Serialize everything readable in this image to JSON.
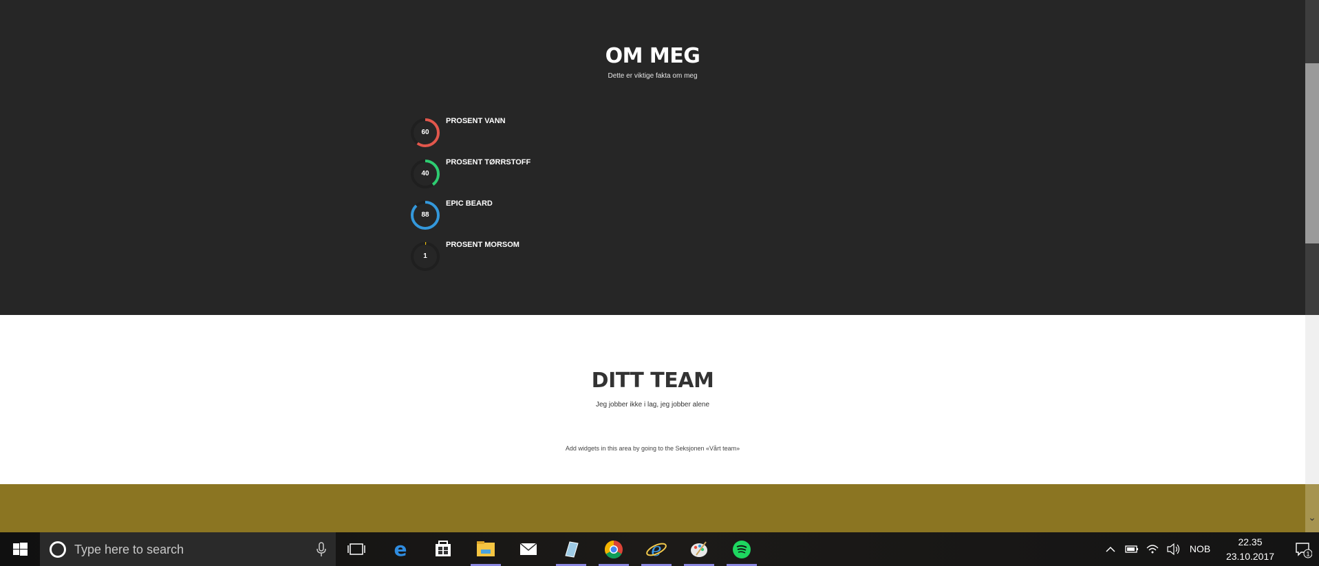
{
  "about": {
    "title": "OM MEG",
    "subtitle": "Dette er viktige fakta om meg",
    "skills": [
      {
        "label": "PROSENT VANN",
        "value": "60",
        "percent": 60,
        "color": "#e2574c"
      },
      {
        "label": "PROSENT TØRRSTOFF",
        "value": "40",
        "percent": 40,
        "color": "#2ecc71"
      },
      {
        "label": "EPIC BEARD",
        "value": "88",
        "percent": 88,
        "color": "#3498db"
      },
      {
        "label": "PROSENT MORSOM",
        "value": "1",
        "percent": 1,
        "color": "#f1c40f"
      }
    ]
  },
  "team": {
    "title": "DITT TEAM",
    "subtitle": "Jeg jobber ikke i lag, jeg jobber alene",
    "widget_note": "Add widgets in this area by going to the Seksjonen «Vårt team»"
  },
  "taskbar": {
    "search_placeholder": "Type here to search",
    "language": "NOB",
    "time": "22.35",
    "date": "23.10.2017",
    "notification_count": "1",
    "apps": [
      "edge-icon",
      "store-icon",
      "file-explorer-icon",
      "mail-icon",
      "notes-icon",
      "chrome-icon",
      "internet-explorer-icon",
      "paint-icon",
      "spotify-icon"
    ]
  },
  "colors": {
    "dark_section": "#262626",
    "gold_section": "#8b7522"
  }
}
